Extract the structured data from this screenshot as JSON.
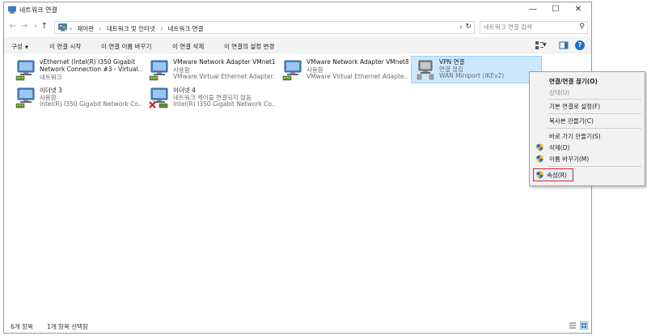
{
  "window": {
    "title": "네트워크 연결",
    "controls": {
      "minimize": "—",
      "maximize": "☐",
      "close": "✕"
    }
  },
  "nav": {
    "back": "←",
    "forward": "→",
    "history": "∨",
    "up": "↑"
  },
  "address": {
    "crumbs": [
      "제어판",
      "네트워크 및 인터넷",
      "네트워크 연결"
    ],
    "separator": "›",
    "dropdown": "∨",
    "refresh": "↻"
  },
  "search": {
    "placeholder": "네트워크 연결 검색",
    "icon": "⚲"
  },
  "commands": {
    "organize": "구성",
    "caret": "▼",
    "start": "이 연결 시작",
    "rename": "이 연결 이름 바꾸기",
    "delete": "이 연결 삭제",
    "settings": "이 연결의 설정 변경"
  },
  "view": {
    "caret": "▼",
    "help": "?"
  },
  "connections": [
    {
      "name": "vEthernet (Intel(R) I350 Gigabit",
      "line2": "Network Connection #3 - Virtual...",
      "line3": "네트워크",
      "icon": "network-adapter-icon"
    },
    {
      "name": "VMware Network Adapter VMnet1",
      "line2": "사용함",
      "line3": "VMware Virtual Ethernet Adapter...",
      "icon": "network-adapter-icon"
    },
    {
      "name": "VMware Network Adapter VMnet8",
      "line2": "사용함",
      "line3": "VMware Virtual Ethernet Adapte...",
      "icon": "network-adapter-icon"
    },
    {
      "name": "VPN 연결",
      "line2": "연결 끊김",
      "line3": "WAN Miniport (IKEv2)",
      "icon": "vpn-icon"
    },
    {
      "name": "이더넷 3",
      "line2": "사용함",
      "line3": "Intel(R) I350 Gigabit Network Co...",
      "icon": "network-adapter-icon"
    },
    {
      "name": "이더넷 4",
      "line2": "네트워크 케이블 연결되지 않음",
      "line3": "Intel(R) I350 Gigabit Network Co...",
      "icon": "network-adapter-disconnected-icon"
    }
  ],
  "status": {
    "count": "6개 항목",
    "selected": "1개 항목 선택함"
  },
  "context_menu": {
    "disconnect": "연결/연결 끊기(O)",
    "status": "상태(U)",
    "set_default": "기본 연결로 설정(F)",
    "copy": "복사본 만들기(C)",
    "shortcut": "바로 가기 만들기(S)",
    "delete": "삭제(D)",
    "rename": "이름 바꾸기(M)",
    "properties": "속성(R)"
  },
  "colors": {
    "selection": "#cce8ff",
    "highlight_border": "#d6272d",
    "help_blue": "#1a73c9"
  }
}
